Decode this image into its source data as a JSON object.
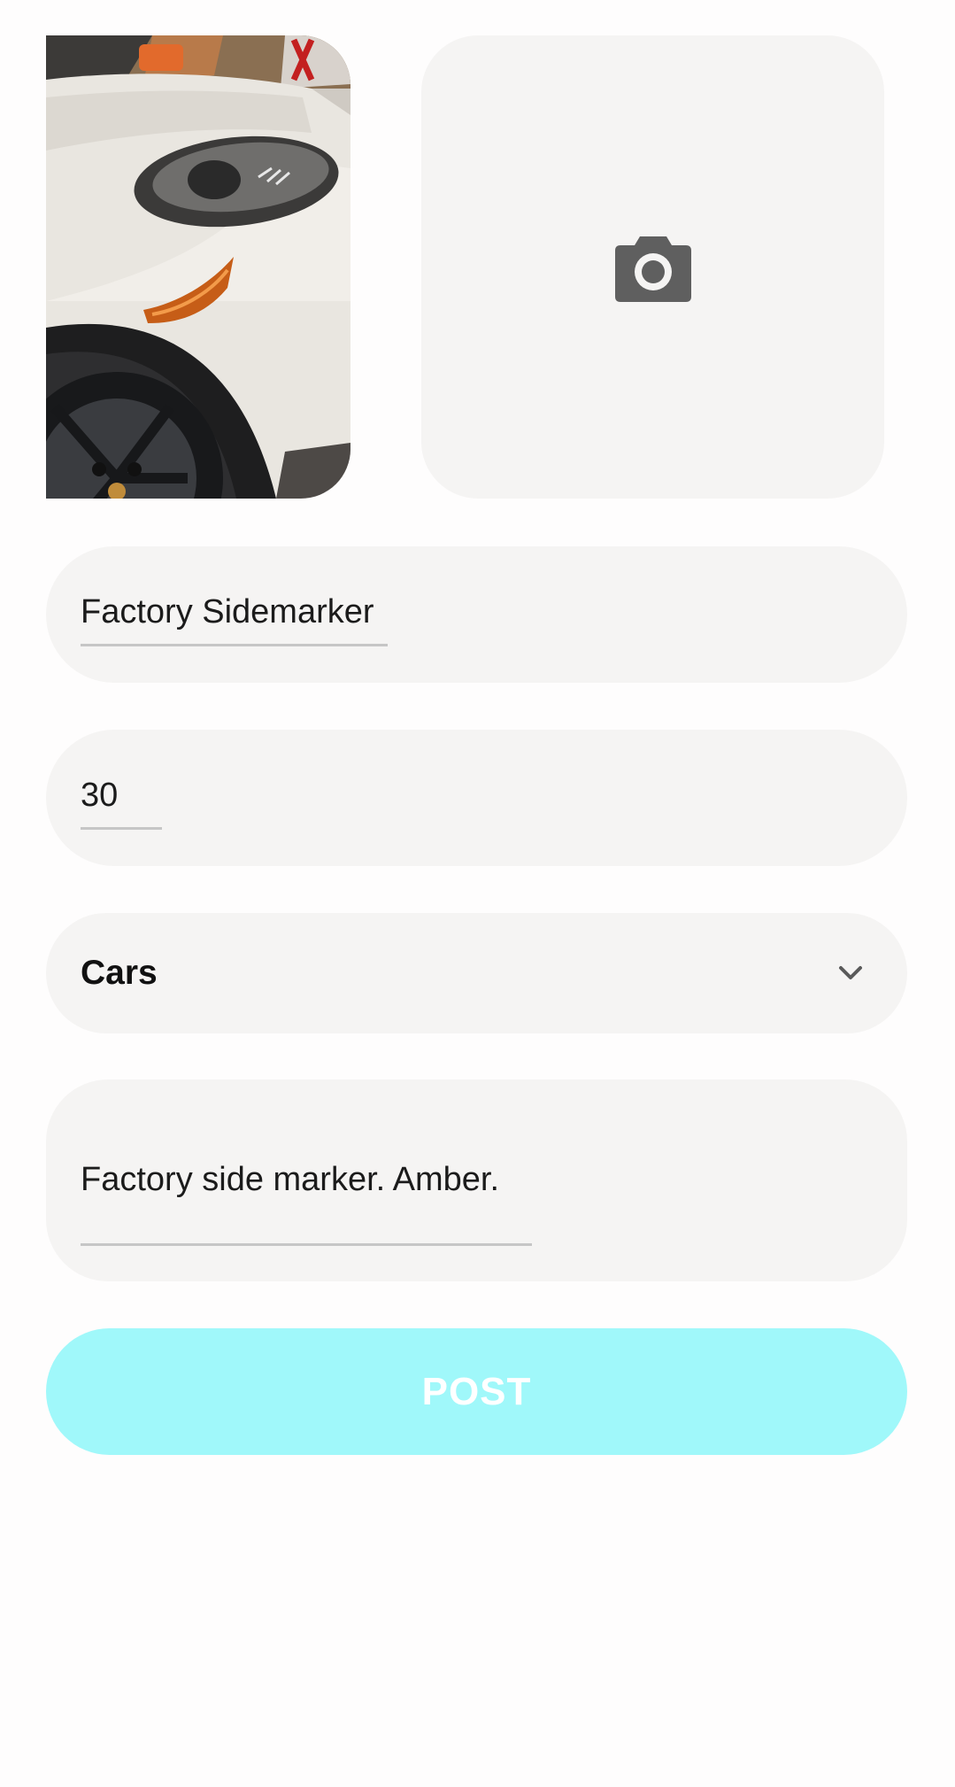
{
  "listing_form": {
    "photo": {
      "alt": "car headlight and amber side marker"
    },
    "add_photo": {
      "icon": "camera-icon"
    },
    "title_field": {
      "value": "Factory Sidemarker"
    },
    "price_field": {
      "value": "30"
    },
    "category_select": {
      "selected": "Cars",
      "icon": "chevron-down-icon"
    },
    "description_field": {
      "value": "Factory side marker. Amber."
    },
    "post_button": {
      "label": "POST"
    }
  },
  "colors": {
    "field_background": "#f5f4f3",
    "button_background": "#a0f8fa",
    "button_text": "#ffffff",
    "icon": "#5f5f5f",
    "underline": "#c6c6c6"
  }
}
